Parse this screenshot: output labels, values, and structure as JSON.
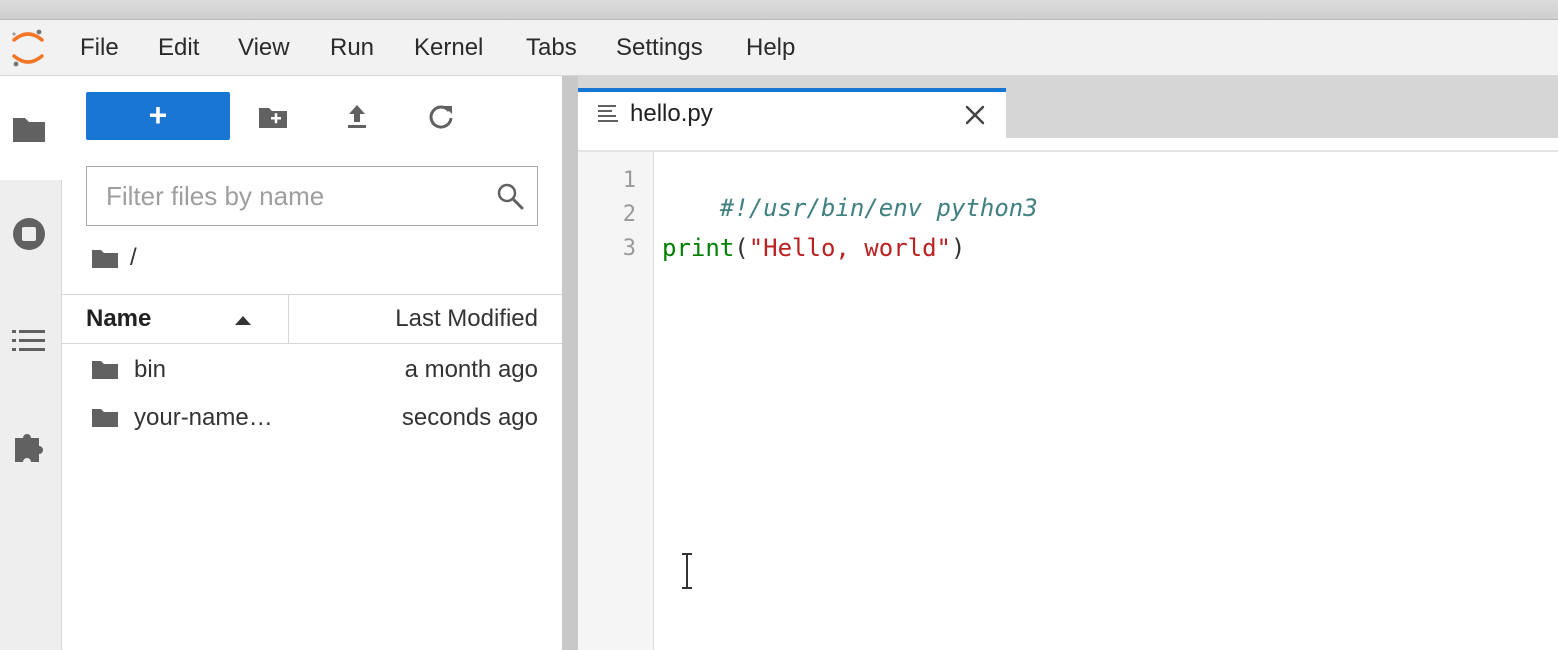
{
  "menubar": {
    "items": [
      "File",
      "Edit",
      "View",
      "Run",
      "Kernel",
      "Tabs",
      "Settings",
      "Help"
    ]
  },
  "left_rail": {
    "icons": [
      "folder-icon",
      "stop-circle-icon",
      "list-icon",
      "puzzle-icon"
    ]
  },
  "file_browser": {
    "new_label": "+",
    "filter_placeholder": "Filter files by name",
    "path": "/",
    "columns": {
      "name": "Name",
      "modified": "Last Modified"
    },
    "files": [
      {
        "name": "bin",
        "modified": "a month ago"
      },
      {
        "name": "your-name…",
        "modified": "seconds ago"
      }
    ]
  },
  "editor": {
    "tab_label": "hello.py",
    "line_numbers": [
      "1",
      "2",
      "3"
    ],
    "code": {
      "line1": "#!/usr/bin/env python3",
      "line3_builtin": "print",
      "line3_open": "(",
      "line3_string": "\"Hello, world\"",
      "line3_close": ")"
    }
  },
  "colors": {
    "accent": "#1976d2",
    "logo_orange": "#f37626",
    "comment": "#408080",
    "builtin": "#008000",
    "string": "#ba2121"
  }
}
